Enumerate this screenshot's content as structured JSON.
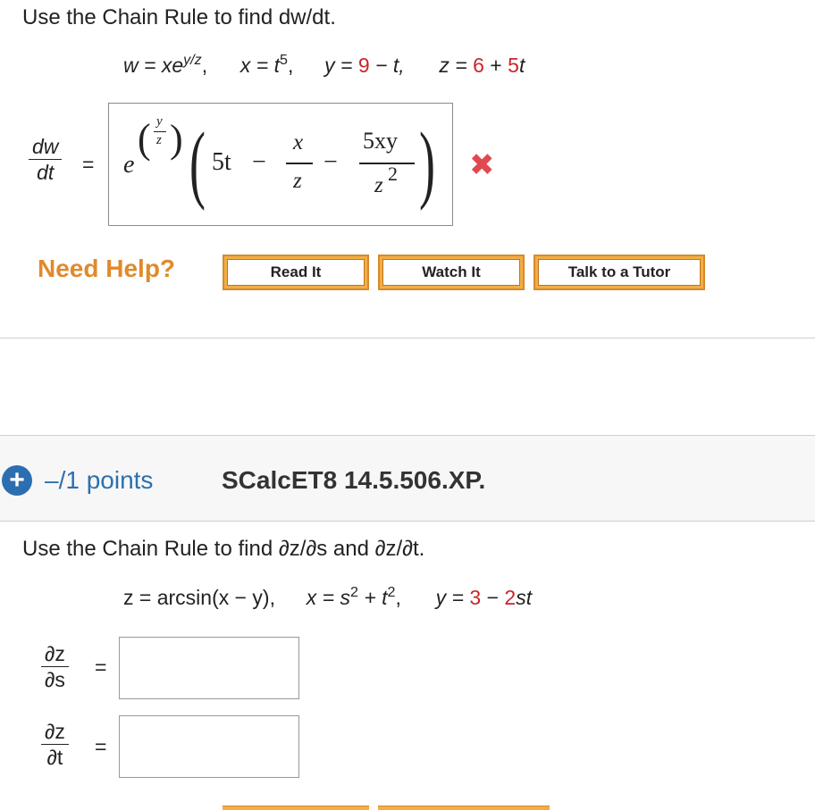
{
  "problem1": {
    "prompt": "Use the Chain Rule to find dw/dt.",
    "given": {
      "w": "w = xe",
      "w_exp": "y/z",
      "w_sep": ",",
      "x": "x = t",
      "x_exp": "5",
      "x_sep": ",",
      "y_pre": "y = ",
      "y_num": "9",
      "y_rest": " − t,",
      "z_pre": "z = ",
      "z_num": "6",
      "z_plus": " + ",
      "z_coef": "5",
      "z_var": "t"
    },
    "lhs_num": "dw",
    "lhs_den": "dt",
    "equals": "=",
    "answer": {
      "e": "e",
      "exp_num": "y",
      "exp_den": "z",
      "term1": "5t",
      "minus1": "−",
      "frac1_num": "x",
      "frac1_den": "z",
      "minus2": "−",
      "frac2_num": "5xy",
      "frac2_den": "z",
      "frac2_den_exp": "2"
    },
    "status_icon": "✖"
  },
  "help": {
    "label": "Need Help?",
    "buttons": [
      "Read It",
      "Watch It",
      "Talk to a Tutor"
    ]
  },
  "problem2": {
    "points": "–/1 points",
    "code": "SCalcET8 14.5.506.XP.",
    "prompt": "Use the Chain Rule to find ∂z/∂s and ∂z/∂t.",
    "given": {
      "z": "z = arcsin(x − y),",
      "x": "x = s",
      "x_exp1": "2",
      "x_mid": " + t",
      "x_exp2": "2",
      "x_sep": ",",
      "y_pre": "y = ",
      "y_num": "3",
      "y_minus": " − ",
      "y_coef": "2",
      "y_var": "st"
    },
    "lhs1_num": "∂z",
    "lhs1_den": "∂s",
    "lhs2_num": "∂z",
    "lhs2_den": "∂t",
    "equals": "=",
    "answer1": "",
    "answer2": ""
  },
  "colors": {
    "accent_red": "#c8262b",
    "help_orange": "#e08a2c",
    "plus_blue": "#2c6fb0",
    "button_fill": "#f2ae45"
  }
}
